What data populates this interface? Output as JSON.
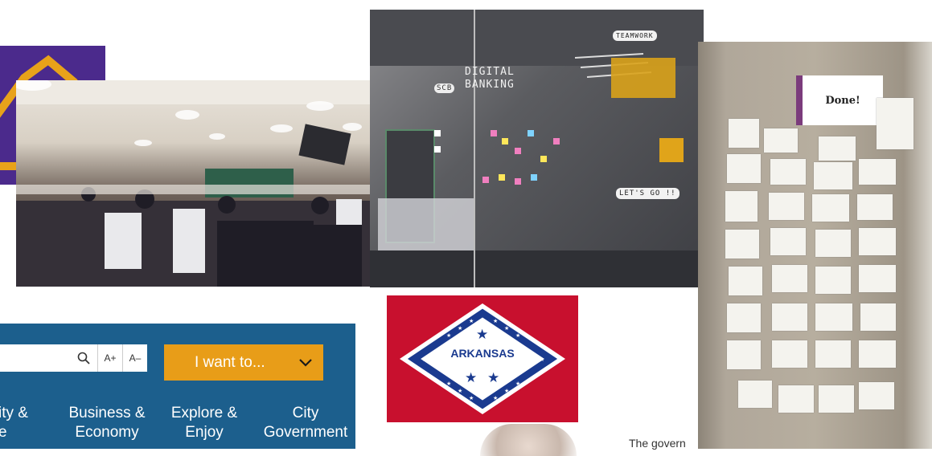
{
  "glass_wall": {
    "label_digital": "DIGITAL",
    "label_banking": "BANKING",
    "label_scb": "SCB",
    "label_teamwork": "TEAMWORK",
    "label_letsgo": "LET'S GO !!"
  },
  "notes_board": {
    "done_label": "Done!"
  },
  "city_site": {
    "search_icon": "search-icon",
    "font_increase": "A+",
    "font_decrease": "A–",
    "i_want_to": "I want to...",
    "nav": [
      {
        "line1": "ity &",
        "line2": "e"
      },
      {
        "line1": "Business &",
        "line2": "Economy"
      },
      {
        "line1": "Explore &",
        "line2": "Enjoy"
      },
      {
        "line1": "City",
        "line2": "Government"
      }
    ],
    "colors": {
      "bar": "#1c5f8d",
      "accent": "#e89d18"
    }
  },
  "flag": {
    "text": "ARKANSAS",
    "colors": {
      "field": "#c8102e",
      "diamond": "#ffffff",
      "band": "#1a3a8f"
    }
  },
  "article": {
    "snippet": "The govern"
  }
}
